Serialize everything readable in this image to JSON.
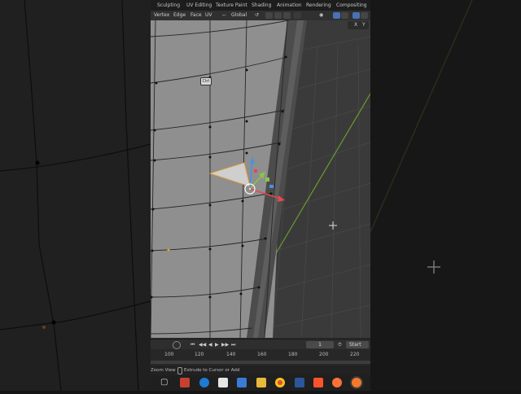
{
  "workspace_tabs": [
    "Sculpting",
    "UV Editing",
    "Texture Paint",
    "Shading",
    "Animation",
    "Rendering",
    "Compositing"
  ],
  "header": {
    "menus": [
      "Vertex",
      "Edge",
      "Face",
      "UV"
    ],
    "transform_orientation": "Global"
  },
  "viewport": {
    "axis_labels": [
      "X",
      "Y"
    ],
    "ctrl_key_label": "Ctrl"
  },
  "timeline": {
    "current_frame": "1",
    "start_label": "Start",
    "ruler_ticks": [
      "100",
      "120",
      "140",
      "160",
      "180",
      "200",
      "220"
    ]
  },
  "statusbar": {
    "zoom_view": "Zoom View",
    "extrude_hint": "Extrude to Cursor or Add"
  },
  "taskbar": {
    "icons": [
      "start-icon",
      "task-view-icon",
      "store-icon",
      "edge-browser-icon",
      "mail-icon",
      "photos-icon",
      "file-explorer-icon",
      "chrome-icon",
      "word-icon",
      "brave-icon",
      "firefox-icon",
      "blender-icon"
    ]
  },
  "colors": {
    "x_axis": "#e5484d",
    "y_axis": "#8bc34a",
    "z_axis": "#4a90e2",
    "selection": "#f0a02a",
    "accent": "#4772b3"
  }
}
